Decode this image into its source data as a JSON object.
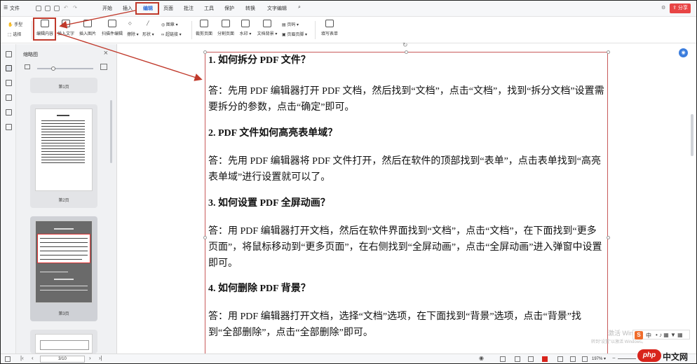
{
  "menubar": {
    "file": "文件",
    "tabs": [
      "开始",
      "插入",
      "编辑",
      "页面",
      "批注",
      "工具",
      "保护",
      "转换",
      "文字编辑"
    ],
    "active_tab": "编辑",
    "share": "分享"
  },
  "ribbon": {
    "hand": "手型",
    "select": "选择",
    "edit_content": "编辑内容",
    "insert_text": "插入文字",
    "insert_image": "插入图片",
    "scan_edit": "扫描件编辑",
    "erase": "擦除",
    "shape": "形状",
    "hyperlink": "超链接",
    "image": "图章",
    "crop_page": "裁剪页面",
    "split_page": "分割页面",
    "watermark": "水印",
    "doc_background": "文档背景",
    "header_footer": "页眉页脚",
    "page_number": "页码",
    "fill_form": "填写表单"
  },
  "thumbnails": {
    "title": "缩略图",
    "pages": [
      {
        "label": "第1页"
      },
      {
        "label": "第2页"
      },
      {
        "label": "第3页"
      }
    ]
  },
  "document": {
    "sections": [
      {
        "heading": "1.  如何拆分 PDF 文件？",
        "answer": "答：先用 PDF 编辑器打开 PDF 文档，然后找到“文档”，点击“文档”，找到“拆分文档”设置需要拆分的参数，点击“确定”即可。"
      },
      {
        "heading": "2.  PDF 文件如何高亮表单域？",
        "answer": "答：先用 PDF 编辑器将 PDF 文件打开，然后在软件的顶部找到“表单”，点击表单找到“高亮表单域”进行设置就可以了。"
      },
      {
        "heading": "3.  如何设置 PDF 全屏动画？",
        "answer": "答：用 PDF 编辑器打开文档，然后在软件界面找到“文档”，点击“文档”，在下面找到“更多页面”，将鼠标移动到“更多页面”，在右侧找到“全屏动画”，点击“全屏动画”进入弹窗中设置即可。"
      },
      {
        "heading": "4.  如何删除 PDF 背景？",
        "answer": "答：用 PDF 编辑器打开文档，选择“文档”选项，在下面找到“背景”选项，点击“背景”找到“全部删除”，点击“全部删除”即可。"
      }
    ]
  },
  "status": {
    "page_indicator": "3/10",
    "zoom": "197%"
  },
  "overlay": {
    "windows_watermark": "激活 Windows",
    "windows_sub": "转到“设置”以激活 Windows。",
    "php_logo": "php",
    "php_cn": "中文网",
    "ime": "中"
  },
  "colors": {
    "accent": "#2f6bd7",
    "highlight": "#c0392b",
    "share": "#e84545"
  }
}
